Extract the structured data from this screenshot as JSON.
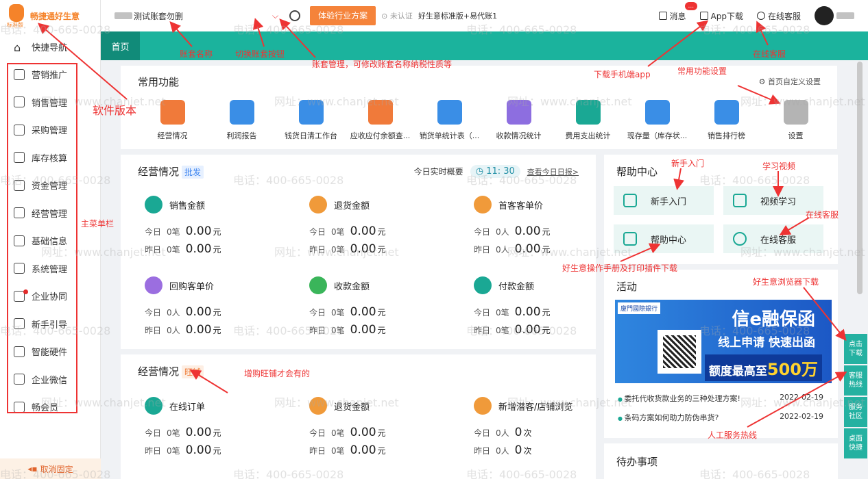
{
  "logo": {
    "brand": "畅捷通好生意",
    "edition": "标准版"
  },
  "menu": [
    "快捷导航",
    "营销推广",
    "销售管理",
    "采购管理",
    "库存核算",
    "资金管理",
    "经营管理",
    "基础信息",
    "系统管理",
    "企业协同",
    "新手引导",
    "智能硬件",
    "企业微信",
    "畅会员"
  ],
  "unpin": "取消固定",
  "topbar": {
    "account": "测试账套勿删",
    "trial": "体验行业方案",
    "cert": "未认证",
    "edition": "好生意标准版+易代账1",
    "message": "消息",
    "app": "App下载",
    "service": "在线客服",
    "badge": "..."
  },
  "tabs": {
    "home": "首页"
  },
  "common": {
    "title": "常用功能",
    "custom": "首页自定义设置",
    "items": [
      {
        "label": "经营情况",
        "color": "#f07a3a"
      },
      {
        "label": "利润报告",
        "color": "#3a8ee6"
      },
      {
        "label": "钱货日清工作台",
        "color": "#3a8ee6"
      },
      {
        "label": "应收应付余额查...",
        "color": "#f07a3a"
      },
      {
        "label": "销货单统计表（...",
        "color": "#3a8ee6"
      },
      {
        "label": "收款情况统计",
        "color": "#8d6ee0"
      },
      {
        "label": "费用支出统计",
        "color": "#1aa894"
      },
      {
        "label": "现存量（库存状...",
        "color": "#3a8ee6"
      },
      {
        "label": "销售排行榜",
        "color": "#3a8ee6"
      },
      {
        "label": "设置",
        "color": "#b4b4b4"
      }
    ]
  },
  "biz": {
    "title": "经营情况",
    "tag": "批发",
    "realtime": "今日实时概要",
    "time": "11: 30",
    "link": "查看今日日报>",
    "today": "今日",
    "yesterday": "昨日",
    "metrics": [
      {
        "name": "销售金额",
        "color": "#1aa894",
        "t1": "0笔",
        "t2": "0.00",
        "y1": "0笔",
        "y2": "0.00",
        "unit": "元"
      },
      {
        "name": "退货金额",
        "color": "#f09a3a",
        "t1": "0笔",
        "t2": "0.00",
        "y1": "0笔",
        "y2": "0.00",
        "unit": "元"
      },
      {
        "name": "首客客单价",
        "color": "#f09a3a",
        "t1": "0人",
        "t2": "0.00",
        "y1": "0人",
        "y2": "0.00",
        "unit": "元"
      },
      {
        "name": "回购客单价",
        "color": "#9b6ee0",
        "t1": "0人",
        "t2": "0.00",
        "y1": "0人",
        "y2": "0.00",
        "unit": "元"
      },
      {
        "name": "收款金额",
        "color": "#3ab55a",
        "t1": "0笔",
        "t2": "0.00",
        "y1": "0笔",
        "y2": "0.00",
        "unit": "元"
      },
      {
        "name": "付款金额",
        "color": "#1aa894",
        "t1": "0笔",
        "t2": "0.00",
        "y1": "0笔",
        "y2": "0.00",
        "unit": "元"
      }
    ]
  },
  "biz2": {
    "title": "经营情况",
    "tag": "旺铺",
    "metrics": [
      {
        "name": "在线订单",
        "color": "#1aa894",
        "t1": "0笔",
        "t2": "0.00",
        "y1": "0笔",
        "y2": "0.00",
        "unit": "元"
      },
      {
        "name": "退货金额",
        "color": "#f09a3a",
        "t1": "0笔",
        "t2": "0.00",
        "y1": "0笔",
        "y2": "0.00",
        "unit": "元"
      },
      {
        "name": "新增潜客/店铺浏览",
        "color": "#f09a3a",
        "t1": "0人",
        "t2": "0",
        "y1": "0人",
        "y2": "0",
        "unit": "次"
      }
    ]
  },
  "help": {
    "title": "帮助中心",
    "items": [
      "新手入门",
      "视频学习",
      "帮助中心",
      "在线客服"
    ]
  },
  "activity": {
    "title": "活动",
    "bank": "廈門國際銀行",
    "h1": "信e融保函",
    "h2": "线上申请 快速出函",
    "h3a": "额度最高至",
    "h3b": "500万",
    "news": [
      {
        "text": "委托代收货款业务的三种处理方案!",
        "date": "2022-02-19"
      },
      {
        "text": "条码方案如何助力防伪串货?",
        "date": "2022-02-19"
      }
    ]
  },
  "todo": {
    "title": "待办事项"
  },
  "float": [
    "点击下载",
    "客服热线",
    "服务社区",
    "桌面快捷"
  ],
  "notes": {
    "version": "软件版本",
    "account": "账套名称",
    "switch": "切换账套按钮",
    "manage": "账套管理，可修改账套名称纳税性质等",
    "app": "下载手机端app",
    "service": "在线客服",
    "common": "常用功能设置",
    "menu": "主菜单栏",
    "newbie": "新手入门",
    "video": "学习视频",
    "online": "在线客服",
    "manual": "好生意操作手册及打印插件下载",
    "browser": "好生意浏览器下载",
    "shop": "增购旺铺才会有的",
    "hotline": "人工服务热线"
  },
  "watermark": {
    "phone": "电话：400-665-0028",
    "site": "网址：www.chanjet.net"
  }
}
